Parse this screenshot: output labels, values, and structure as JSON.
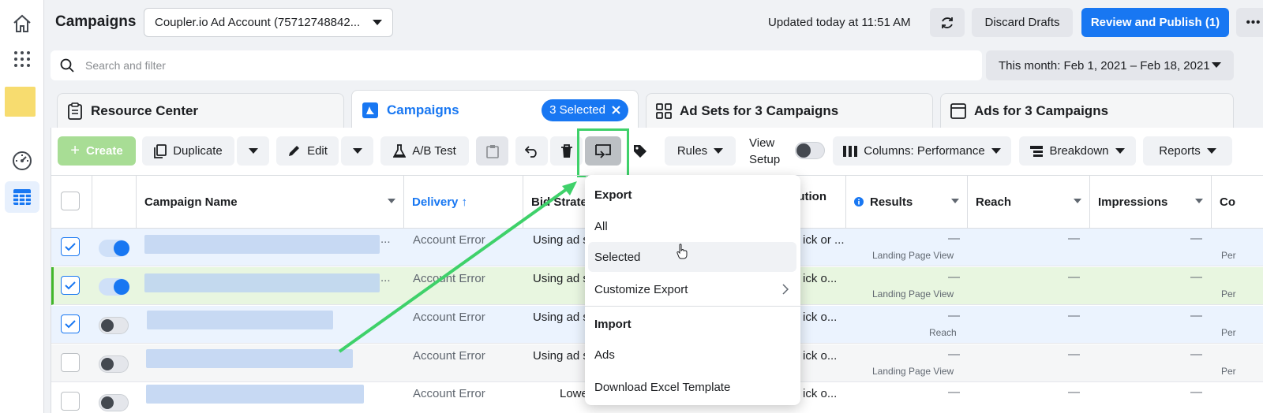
{
  "topbar": {
    "title": "Campaigns",
    "account": "Coupler.io Ad Account (75712748842...",
    "updated": "Updated today at 11:51 AM",
    "discard": "Discard Drafts",
    "publish": "Review and Publish (1)",
    "more": "•••"
  },
  "search": {
    "placeholder": "Search and filter",
    "daterange": "This month: Feb 1, 2021 – Feb 18, 2021"
  },
  "tabs": {
    "resource": "Resource Center",
    "campaigns": "Campaigns",
    "selected": "3 Selected",
    "adsets": "Ad Sets for 3 Campaigns",
    "ads": "Ads for 3 Campaigns"
  },
  "toolbar": {
    "create": "Create",
    "duplicate": "Duplicate",
    "edit": "Edit",
    "abtest": "A/B Test",
    "rules": "Rules",
    "view_line1": "View",
    "view_line2": "Setup",
    "columns": "Columns: Performance",
    "breakdown": "Breakdown",
    "reports": "Reports"
  },
  "table": {
    "headers": {
      "name": "Campaign Name",
      "delivery": "Delivery ↑",
      "bid": "Bid Strategy",
      "attribution": "ution",
      "results": "Results",
      "reach": "Reach",
      "impressions": "Impressions",
      "cost": "Co"
    },
    "rows": [
      {
        "delivery": "Account Error",
        "bid": "Using ad s",
        "attr": "ick or ...",
        "result_sub": "Landing Page View",
        "dash": "—",
        "cost_sub": "Per"
      },
      {
        "delivery": "Account Error",
        "bid": "Using ad s",
        "attr": "ick o...",
        "result_sub": "Landing Page View",
        "dash": "—",
        "cost_sub": "Per"
      },
      {
        "delivery": "Account Error",
        "bid": "Using ad s",
        "attr": "ick o...",
        "result_sub": "Reach",
        "dash": "—",
        "cost_sub": "Per"
      },
      {
        "delivery": "Account Error",
        "bid": "Using ad s",
        "attr": "ick o...",
        "result_sub": "Landing Page View",
        "dash": "—",
        "cost_sub": "Per"
      },
      {
        "delivery": "Account Error",
        "bid": "Lowe",
        "attr": "ick o...",
        "result_sub": "",
        "dash": "—",
        "cost_sub": ""
      }
    ]
  },
  "menu": {
    "export_head": "Export",
    "all": "All",
    "selected": "Selected",
    "customize": "Customize Export",
    "import_head": "Import",
    "ads": "Ads",
    "template": "Download Excel Template"
  },
  "colors": {
    "accent": "#1877f2",
    "highlight": "#3fd16a"
  }
}
